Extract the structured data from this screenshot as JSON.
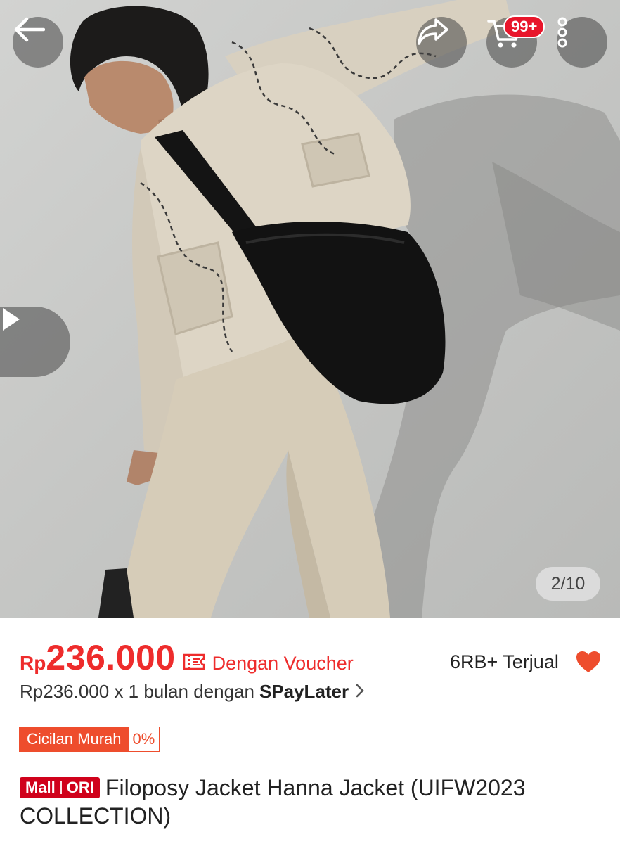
{
  "gallery": {
    "counter": "2/10",
    "cart_badge": "99+"
  },
  "product": {
    "currency": "Rp",
    "price": "236.000",
    "voucher_label": "Dengan Voucher",
    "sold": "6RB+ Terjual",
    "paylater_text": "Rp236.000 x 1 bulan dengan",
    "paylater_brand": "SPayLater",
    "installment_label": "Cicilan Murah",
    "installment_rate": "0%",
    "mall_label": "Mall",
    "ori_label": "ORI",
    "title": "Filoposy Jacket Hanna Jacket (UIFW2023 COLLECTION)"
  },
  "colors": {
    "price_red": "#ee2c2c",
    "badge_red": "#e8162b",
    "mall_red": "#d0011b",
    "installment_orange": "#ee4d2d",
    "heart": "#ee4d2d"
  },
  "icons": [
    "back-arrow-icon",
    "share-icon",
    "cart-icon",
    "more-vertical-icon",
    "play-icon",
    "voucher-icon",
    "heart-icon",
    "chevron-right-icon"
  ]
}
